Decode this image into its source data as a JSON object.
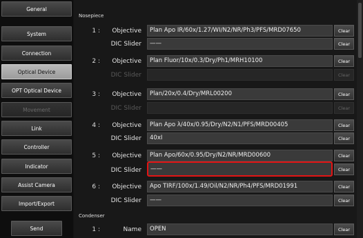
{
  "sidebar": {
    "items": [
      {
        "label": "General",
        "state": "normal"
      },
      {
        "label": "System",
        "state": "normal"
      },
      {
        "label": "Connection",
        "state": "normal"
      },
      {
        "label": "Optical Device",
        "state": "active"
      },
      {
        "label": "OPT Optical Device",
        "state": "normal"
      },
      {
        "label": "Movement",
        "state": "disabled"
      },
      {
        "label": "Link",
        "state": "normal"
      },
      {
        "label": "Controller",
        "state": "normal"
      },
      {
        "label": "Indicator",
        "state": "normal"
      },
      {
        "label": "Assist Camera",
        "state": "normal"
      },
      {
        "label": "Import/Export",
        "state": "normal"
      }
    ],
    "send_label": "Send"
  },
  "nosepiece": {
    "title": "Nosepiece",
    "objective_label": "Objective",
    "dic_label": "DIC Slider",
    "clear_label": "Clear",
    "positions": [
      {
        "num": "1 :",
        "objective": "Plan Apo IR/60x/1.27/WI/N2/NR/Ph3/PFS/MRD07650",
        "dic": "——",
        "dic_enabled": true
      },
      {
        "num": "2 :",
        "objective": "Plan Fluor/10x/0.3/Dry/Ph1/MRH10100",
        "dic": "",
        "dic_enabled": false
      },
      {
        "num": "3 :",
        "objective": "Plan/20x/0.4/Dry/MRL00200",
        "dic": "",
        "dic_enabled": false
      },
      {
        "num": "4 :",
        "objective": "Plan Apo λ/40x/0.95/Dry/N2/N1/PFS/MRD00405",
        "dic": "40xI",
        "dic_enabled": true
      },
      {
        "num": "5 :",
        "objective": "Plan Apo/60x/0.95/Dry/N2/NR/MRD00600",
        "dic": "——",
        "dic_enabled": true
      },
      {
        "num": "6 :",
        "objective": "Apo TIRF/100x/1.49/Oil/N2/NR/Ph4/PFS/MRD01991",
        "dic": "——",
        "dic_enabled": true
      }
    ]
  },
  "condenser": {
    "title": "Condenser",
    "num": "1 :",
    "name_label": "Name",
    "name_value": "OPEN"
  }
}
